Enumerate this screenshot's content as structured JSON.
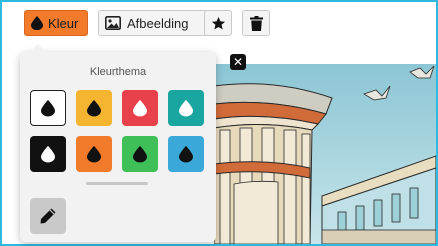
{
  "toolbar": {
    "color_label": "Kleur",
    "image_label": "Afbeelding",
    "star_icon": "star-icon",
    "trash_icon": "trash-icon"
  },
  "color_popover": {
    "title": "Kleurthema",
    "swatches": [
      {
        "bg": "#ffffff",
        "drop": "#111111",
        "selected": true
      },
      {
        "bg": "#f5b531",
        "drop": "#111111",
        "selected": false
      },
      {
        "bg": "#e8414b",
        "drop": "#ffffff",
        "selected": false
      },
      {
        "bg": "#1aa6a0",
        "drop": "#ffffff",
        "selected": false
      },
      {
        "bg": "#111111",
        "drop": "#ffffff",
        "selected": false
      },
      {
        "bg": "#f27a2b",
        "drop": "#111111",
        "selected": false
      },
      {
        "bg": "#3fbf57",
        "drop": "#111111",
        "selected": false
      },
      {
        "bg": "#3aa8d8",
        "drop": "#111111",
        "selected": false
      }
    ],
    "edit_icon": "pencil-icon"
  },
  "colors": {
    "accent": "#f27a2b",
    "frame": "#2fb9e0"
  },
  "image": {
    "close_icon": "close-icon",
    "description_icon": "illustration-image"
  }
}
